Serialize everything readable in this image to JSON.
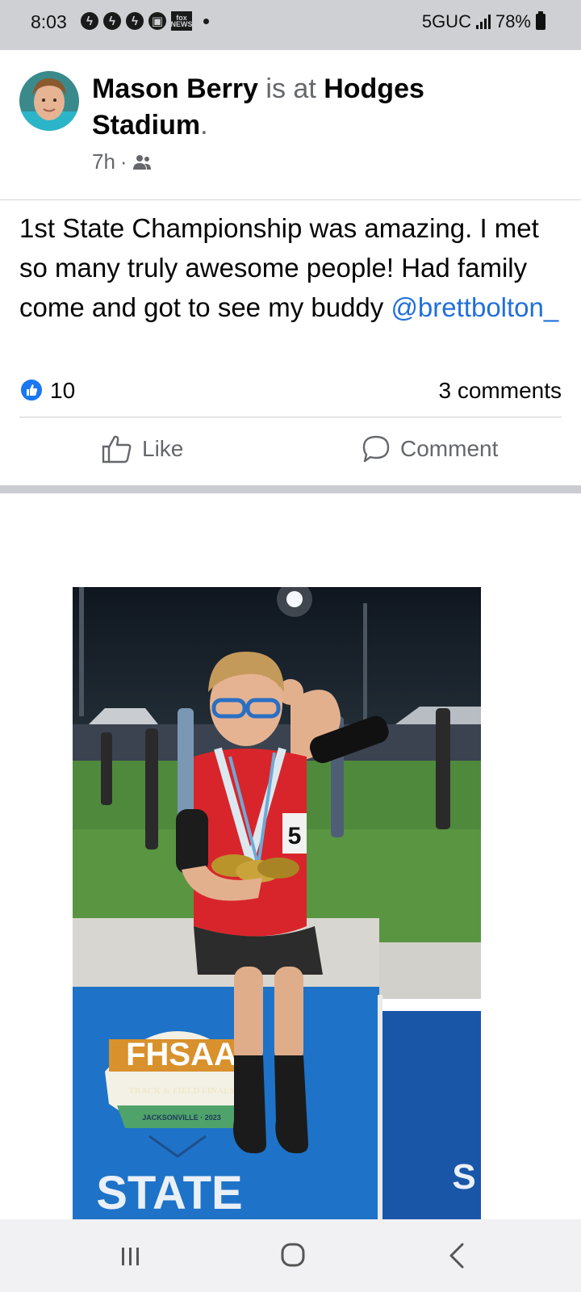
{
  "status_bar": {
    "time": "8:03",
    "network": "5GUC",
    "battery": "78%",
    "notification_icons": [
      "messenger-icon",
      "messenger-icon",
      "messenger-icon",
      "lock-icon",
      "fox-news-icon"
    ],
    "fox_news_label": "fox NEWS"
  },
  "post": {
    "author": "Mason Berry",
    "is_at": " is at ",
    "place": "Hodges Stadium",
    "place_suffix": ".",
    "time_ago": "7h",
    "separator": " · ",
    "audience_icon": "friends-icon",
    "text": "1st State Championship was amazing. I met so many truly awesome people! Had family come and got to see my buddy ",
    "mention": "@brettbolton_",
    "like_count": "10",
    "comment_count": "3 comments"
  },
  "actions": {
    "like_label": "Like",
    "comment_label": "Comment"
  },
  "photo": {
    "logo_text": "FHSAA",
    "banner_text": "TRACK & FIELD FINALS",
    "location_text": "JACKSONVILLE · 2023",
    "state_text": "STATE",
    "side_text": "S",
    "bib_number": "5"
  },
  "colors": {
    "link": "#216fdb",
    "like_blue": "#1877f2",
    "muted": "#65676b",
    "status_bar": "#cfd0d4"
  }
}
